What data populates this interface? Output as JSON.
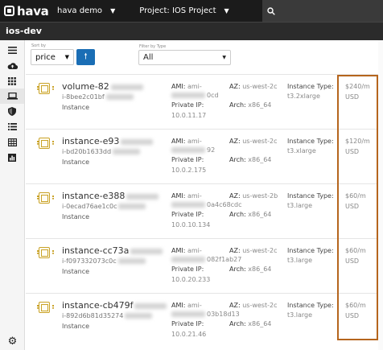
{
  "app": {
    "logo_text": "hava"
  },
  "topbar": {
    "workspace": "hava demo",
    "project": "Project: IOS Project",
    "search_placeholder": ""
  },
  "page": {
    "title": "ios-dev"
  },
  "controls": {
    "sort_label": "Sort by",
    "sort_value": "price",
    "sort_direction_icon": "arrow-up-icon",
    "filter_label": "Filter by Type",
    "filter_value": "All"
  },
  "sidebar": {
    "items": [
      "menu-icon",
      "cloud-upload-icon",
      "grid-icon",
      "laptop-icon",
      "shield-icon",
      "list-icon",
      "table-icon",
      "chart-icon"
    ],
    "active": "laptop-icon",
    "bottom": "gear-icon"
  },
  "colors": {
    "accent": "#1a6eb5",
    "highlight": "#b5651d",
    "chip": "#c9a227",
    "topbar": "#1b1b1b"
  },
  "rows": [
    {
      "name": "volume-82",
      "id": "i-8bee2c01bf",
      "type": "Instance",
      "ami_label": "AMI:",
      "ami": "ami-",
      "ami_tail": "0cd",
      "az_label": "AZ:",
      "az": "us-west-2c",
      "itype_label": "Instance Type:",
      "itype": "t3.2xlarge",
      "ip_label": "Private IP:",
      "ip": "10.0.11.17",
      "arch_label": "Arch:",
      "arch": "x86_64",
      "price": "$240/m",
      "currency": "USD"
    },
    {
      "name": "instance-e93",
      "id": "i-bd20b1633dd",
      "type": "Instance",
      "ami_label": "AMI:",
      "ami": "ami-",
      "ami_tail": "92",
      "az_label": "AZ:",
      "az": "us-west-2c",
      "itype_label": "Instance Type:",
      "itype": "t3.xlarge",
      "ip_label": "Private IP:",
      "ip": "10.0.2.175",
      "arch_label": "Arch:",
      "arch": "x86_64",
      "price": "$120/m",
      "currency": "USD"
    },
    {
      "name": "instance-e388",
      "id": "i-0ecad76ae1c0c",
      "type": "Instance",
      "ami_label": "AMI:",
      "ami": "ami-",
      "ami_tail": "0a4c68cdc",
      "az_label": "AZ:",
      "az": "us-west-2b",
      "itype_label": "Instance Type:",
      "itype": "t3.large",
      "ip_label": "Private IP:",
      "ip": "10.0.10.134",
      "arch_label": "Arch:",
      "arch": "x86_64",
      "price": "$60/m",
      "currency": "USD"
    },
    {
      "name": "instance-cc73a",
      "id": "i-f097332073c0c",
      "type": "Instance",
      "ami_label": "AMI:",
      "ami": "ami-",
      "ami_tail": "082f1ab27",
      "az_label": "AZ:",
      "az": "us-west-2c",
      "itype_label": "Instance Type:",
      "itype": "t3.large",
      "ip_label": "Private IP:",
      "ip": "10.0.20.233",
      "arch_label": "Arch:",
      "arch": "x86_64",
      "price": "$60/m",
      "currency": "USD"
    },
    {
      "name": "instance-cb479f",
      "id": "i-892d6b81d35274",
      "type": "Instance",
      "ami_label": "AMI:",
      "ami": "ami-",
      "ami_tail": "03b18d13",
      "az_label": "AZ:",
      "az": "us-west-2c",
      "itype_label": "Instance Type:",
      "itype": "t3.large",
      "ip_label": "Private IP:",
      "ip": "10.0.21.46",
      "arch_label": "Arch:",
      "arch": "x86_64",
      "price": "$60/m",
      "currency": "USD"
    }
  ]
}
